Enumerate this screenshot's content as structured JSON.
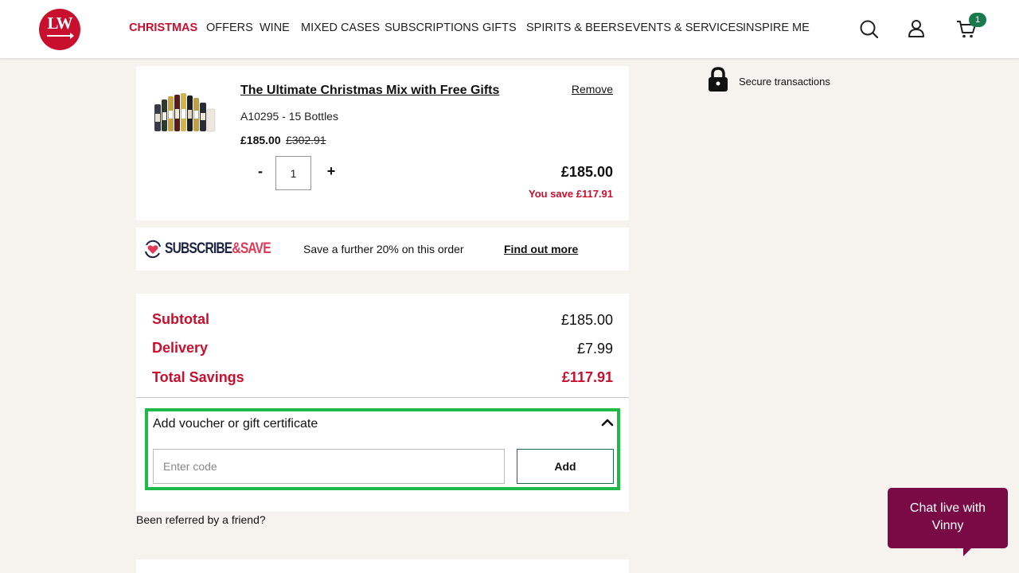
{
  "header": {
    "logo_text": "LW",
    "nav": [
      {
        "label": "CHRISTMAS",
        "active": true
      },
      {
        "label": "OFFERS"
      },
      {
        "label": "WINE"
      },
      {
        "label": "MIXED CASES"
      },
      {
        "label": "SUBSCRIPTIONS"
      },
      {
        "label": "GIFTS"
      },
      {
        "label": "SPIRITS & BEERS"
      },
      {
        "label": "EVENTS & SERVICES"
      },
      {
        "label": "INSPIRE ME"
      }
    ],
    "icons": [
      "search-icon",
      "account-icon",
      "cart-icon"
    ],
    "cart_count": "1"
  },
  "secure": {
    "label": "Secure transactions",
    "icon": "lock-icon"
  },
  "product": {
    "title": "The Ultimate Christmas Mix with Free Gifts",
    "remove_label": "Remove",
    "code": "A10295 - 15 Bottles",
    "price_now": "£185.00",
    "price_was": "£302.91",
    "qty_minus": "-",
    "quantity": "1",
    "qty_plus": "+",
    "line_total": "£185.00",
    "you_save": "You save £117.91"
  },
  "subscribe": {
    "brand_a": "SUBSCRIBE",
    "brand_b": "&SAVE",
    "message": "Save a further 20% on this order",
    "link": "Find out more"
  },
  "summary": {
    "subtotal_label": "Subtotal",
    "subtotal_value": "£185.00",
    "delivery_label": "Delivery",
    "delivery_value": "£7.99",
    "savings_label": "Total Savings",
    "savings_value": "£117.91"
  },
  "voucher": {
    "title": "Add voucher or gift certificate",
    "placeholder": "Enter code",
    "value": "",
    "add_label": "Add"
  },
  "referred": "Been referred by a friend?",
  "chat": {
    "line1": "Chat live with",
    "line2": "Vinny"
  },
  "colors": {
    "brand": "#c8102e",
    "chat": "#7a0a45",
    "highlight": "#1fba4a",
    "badge": "#1a7a4b"
  }
}
